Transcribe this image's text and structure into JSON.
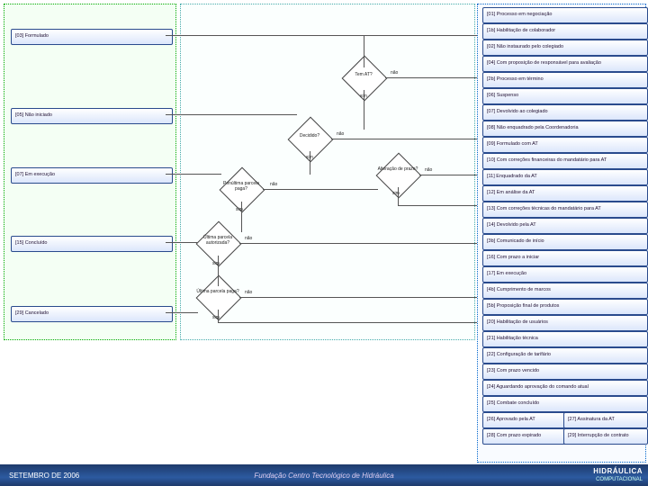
{
  "footer": {
    "date": "SETEMBRO DE 2006",
    "org": "Fundação Centro Tecnológico de Hidráulica",
    "brand": "HIDRÁULICA",
    "brand_sub": "COMPUTACIONAL"
  },
  "left_states": {
    "s03": "[03] Formulado",
    "s05": "[05] Não iniciado",
    "s07": "[07] Em execução",
    "s15": "[15] Concluído",
    "s29": "[29] Cancelado"
  },
  "right_states": {
    "s01": "[01] Processo em negociação",
    "s1b": "[1b] Habilitação de colaborador",
    "s02": "[02] Não instaurado pelo colegiado",
    "s04": "[04] Com proposição de responsável para avaliação",
    "s2b": "[2b] Processo em término",
    "s06": "[06] Suspenso",
    "s07b": "[07] Devolvido ao colegiado",
    "s08": "[08] Não enquadrado pela Coordenadoria",
    "s09": "[09] Formulado com AT",
    "s10": "[10] Com correções financeiras do mandatário para AT",
    "s11": "[11] Enquadrado da AT",
    "s12": "[12] Em análise da AT",
    "s13": "[13] Com correções técnicas do mandatário para AT",
    "s14": "[14] Devolvido pela AT",
    "s3b": "[3b] Comunicado de início",
    "s16": "[16] Com prazo a iniciar",
    "s17": "[17] Em execução",
    "s4b": "[4b] Cumprimento de marcos",
    "s5b": "[5b] Proposição final de produtos",
    "s20": "[20] Habilitação de usuários",
    "s21": "[21] Habilitação técnica",
    "s22": "[22] Configuração de tarifário",
    "s23": "[23] Com prazo vencido",
    "s24": "[24] Aguardando aprovação do comando atual",
    "s25": "[25] Combate concluído",
    "s26": "[26] Aprovado pela AT",
    "s27": "[27] Assinatura da AT",
    "s28": "[28] Com prazo expirado",
    "s29b": "[29] Interrupção de contrato"
  },
  "decisions": {
    "d1": {
      "q": "Tem AT?",
      "yes": "não",
      "no": "sim"
    },
    "d2": {
      "q": "Decidido?",
      "yes": "não",
      "no": "sim"
    },
    "d3": {
      "q": "Penúltima parcela paga?",
      "yes": "sim",
      "no": "não"
    },
    "d4": {
      "q": "Alteração de prazo?",
      "yes": "sim",
      "no": "não"
    },
    "d5": {
      "q": "Última parcela autorizada?",
      "yes": "sim",
      "no": "não"
    },
    "d6": {
      "q": "Última parcela paga?",
      "yes": "sim",
      "no": "não"
    }
  }
}
